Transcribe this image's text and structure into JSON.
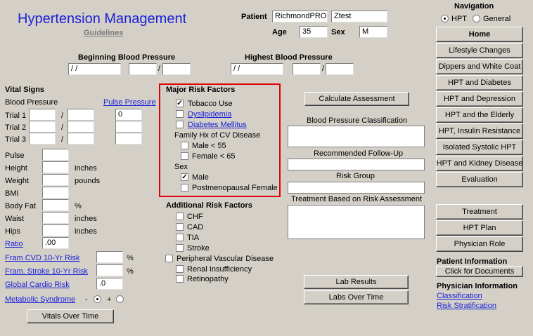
{
  "header": {
    "title": "Hypertension Management",
    "guidelines": "Guidelines"
  },
  "patient": {
    "label": "Patient",
    "first": "RichmondPROD",
    "last": "Ztest",
    "age_label": "Age",
    "age": "35",
    "sex_label": "Sex",
    "sex": "M"
  },
  "bp": {
    "beginning_label": "Beginning Blood Pressure",
    "highest_label": "Highest Blood Pressure",
    "date_placeholder": " /  /",
    "slash": "/"
  },
  "vitals": {
    "title": "Vital Signs",
    "bp_label": "Blood Pressure",
    "pulse_pressure": "Pulse Pressure",
    "trial1": "Trial 1",
    "trial2": "Trial 2",
    "trial3": "Trial 3",
    "pp1": "0",
    "slash": "/",
    "pulse": "Pulse",
    "height": "Height",
    "weight": "Weight",
    "bmi": "BMI",
    "body_fat": "Body Fat",
    "waist": "Waist",
    "hips": "Hips",
    "ratio": "Ratio",
    "ratio_value": ".00",
    "inches": "inches",
    "pounds": "pounds",
    "percent": "%",
    "fram_cvd": "Fram CVD 10-Yr Risk",
    "fram_stroke": "Fram. Stroke 10-Yr Risk",
    "global": "Global Cardio Risk",
    "global_value": ".0",
    "metabolic": "Metabolic Syndrome",
    "minus": "-",
    "plus": "+",
    "vitals_btn": "Vitals Over Time"
  },
  "major": {
    "title": "Major Risk Factors",
    "tobacco": "Tobacco Use",
    "dyslipidemia": "Dyslipidemia",
    "diabetes": "Diabetes Mellitus",
    "family": "Family Hx of CV Disease",
    "male55": "Male < 55",
    "female65": "Female < 65",
    "sex": "Sex",
    "male": "Male",
    "postmeno": "Postmenopausal Female"
  },
  "additional": {
    "title": "Additional Risk Factors",
    "chf": "CHF",
    "cad": "CAD",
    "tia": "TIA",
    "stroke": "Stroke",
    "pvd": "Peripheral Vascular Disease",
    "renal": "Renal Insufficiency",
    "retino": "Retinopathy"
  },
  "assess": {
    "calc": "Calculate Assessment",
    "bp_class": "Blood Pressure Classification",
    "followup": "Recommended Follow-Up",
    "risk_group": "Risk Group",
    "treatment": "Treatment Based on Risk Assessment",
    "lab_results": "Lab Results",
    "labs_over_time": "Labs Over Time"
  },
  "nav": {
    "title": "Navigation",
    "hpt": "HPT",
    "general": "General",
    "buttons": [
      "Home",
      "Lifestyle Changes",
      "Dippers and White Coat",
      "HPT and Diabetes",
      "HPT and Depression",
      "HPT and the Elderly",
      "HPT,  Insulin Resistance",
      "Isolated Systolic HPT",
      "HPT and Kidney Disease",
      "Evaluation"
    ],
    "lower": [
      "Treatment",
      "HPT Plan",
      "Physician Role"
    ],
    "patient_info": "Patient Information",
    "click_docs": "Click for Documents",
    "physician_info": "Physician Information",
    "classification": "Classification",
    "risk_strat": "Risk Stratification"
  }
}
